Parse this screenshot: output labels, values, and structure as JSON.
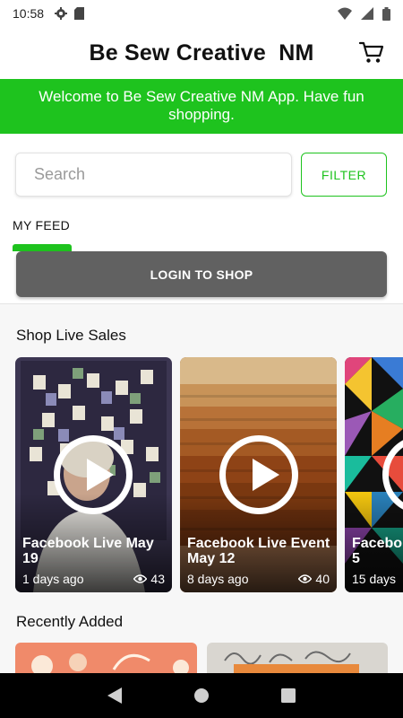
{
  "status_bar": {
    "time": "10:58"
  },
  "header": {
    "title": "Be Sew Creative  NM"
  },
  "banner": {
    "text": "Welcome to Be Sew Creative NM App.  Have fun shopping."
  },
  "search": {
    "placeholder": "Search",
    "filter_label": "FILTER"
  },
  "feed": {
    "tab_label": "MY FEED"
  },
  "login": {
    "label": "LOGIN TO SHOP"
  },
  "live_sales": {
    "title": "Shop Live Sales",
    "cards": [
      {
        "title": "Facebook Live May 19",
        "age": "1 days ago",
        "views": "43"
      },
      {
        "title": "Facebook Live Event May 12",
        "age": "8 days ago",
        "views": "40"
      },
      {
        "title": "Facebo 5",
        "age": "15 days",
        "views": ""
      }
    ]
  },
  "recently_added": {
    "title": "Recently Added"
  },
  "colors": {
    "accent": "#1ec31e",
    "login_button": "#616161"
  }
}
